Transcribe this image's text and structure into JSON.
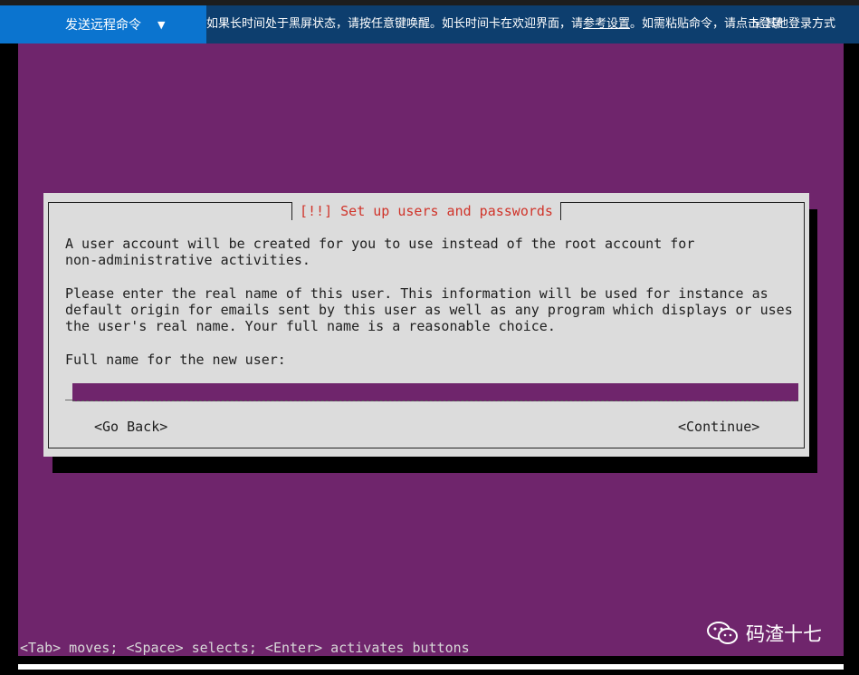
{
  "toolbar": {
    "send_command_label": "发送远程命令",
    "notice_part1": "如果长时间处于黑屏状态，请按任意键唤醒。如长时间卡在欢迎界面，请",
    "notice_link": "参考设置",
    "notice_part2": "。如需粘贴命令，请点击登录",
    "other_login_label": "其他登录方式"
  },
  "dialog": {
    "title": "[!!] Set up users and passwords",
    "paragraph1": "A user account will be created for you to use instead of the root account for\nnon-administrative activities.",
    "paragraph2": "Please enter the real name of this user. This information will be used for instance as\ndefault origin for emails sent by this user as well as any program which displays or uses\nthe user's real name. Your full name is a reasonable choice.",
    "field_label": "Full name for the new user:",
    "field_value": "",
    "go_back": "<Go Back>",
    "continue": "<Continue>"
  },
  "status_hint": "<Tab> moves; <Space> selects; <Enter> activates buttons",
  "watermark": "码渣十七",
  "colors": {
    "terminal_bg": "#6f256c",
    "dialog_bg": "#dcdcdc",
    "title_red": "#d0342a",
    "toolbar_blue": "#0b74cf"
  }
}
